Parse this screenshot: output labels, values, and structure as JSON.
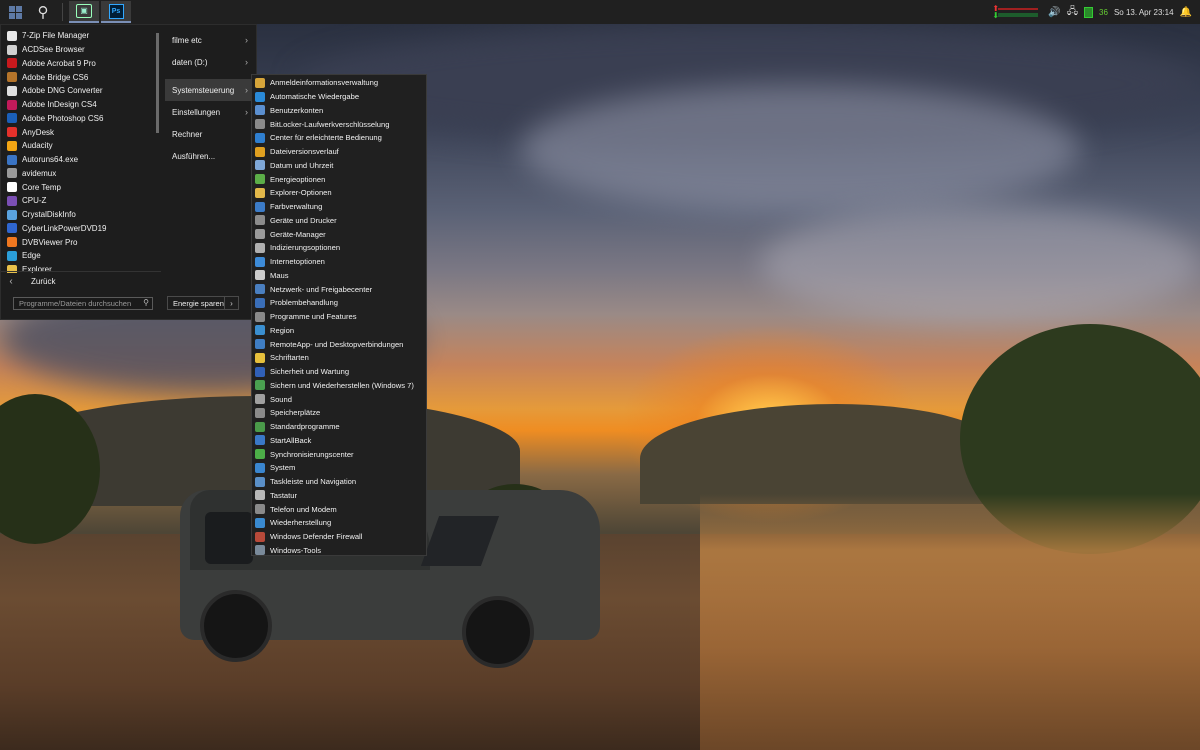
{
  "taskbar": {
    "clock": "So 13. Apr  23:14",
    "tray_number": "36",
    "apps": [
      {
        "name": "control-panel-app",
        "label": ""
      },
      {
        "name": "photoshop-app",
        "label": "Ps"
      }
    ]
  },
  "start_menu": {
    "programs": [
      {
        "label": "7-Zip File Manager",
        "color": "#e8e8e8"
      },
      {
        "label": "ACDSee Browser",
        "color": "#d0d0d0"
      },
      {
        "label": "Adobe Acrobat 9 Pro",
        "color": "#c8191d"
      },
      {
        "label": "Adobe Bridge CS6",
        "color": "#b5742a"
      },
      {
        "label": "Adobe DNG Converter",
        "color": "#e0e0e0"
      },
      {
        "label": "Adobe InDesign CS4",
        "color": "#c21a5a"
      },
      {
        "label": "Adobe Photoshop CS6",
        "color": "#1b5fb8"
      },
      {
        "label": "AnyDesk",
        "color": "#e5312b"
      },
      {
        "label": "Audacity",
        "color": "#f3a514"
      },
      {
        "label": "Autoruns64.exe",
        "color": "#3a74c4"
      },
      {
        "label": "avidemux",
        "color": "#9a9a9a"
      },
      {
        "label": "Core Temp",
        "color": "#ffffff"
      },
      {
        "label": "CPU-Z",
        "color": "#7b4fb4"
      },
      {
        "label": "CrystalDiskInfo",
        "color": "#5aa3e0"
      },
      {
        "label": "CyberLinkPowerDVD19",
        "color": "#2f66d0"
      },
      {
        "label": "DVBViewer Pro",
        "color": "#f07820"
      },
      {
        "label": "Edge",
        "color": "#2b9ed8"
      },
      {
        "label": "Explorer",
        "color": "#e8c04a"
      }
    ],
    "back_label": "Zurück",
    "search_placeholder": "Programme/Dateien durchsuchen",
    "right_items": [
      {
        "label": "filme etc",
        "has_arrow": true
      },
      {
        "label": "daten (D:)",
        "has_arrow": true
      },
      {
        "label": "Systemsteuerung",
        "has_arrow": true,
        "active": true
      },
      {
        "label": "Einstellungen",
        "has_arrow": true
      },
      {
        "label": "Rechner",
        "has_arrow": false
      },
      {
        "label": "Ausführen...",
        "has_arrow": false
      }
    ],
    "power_label": "Energie sparen"
  },
  "control_panel": {
    "items": [
      {
        "label": "Anmeldeinformationsverwaltung",
        "color": "#d6a53a"
      },
      {
        "label": "Automatische Wiedergabe",
        "color": "#2a8ad8"
      },
      {
        "label": "Benutzerkonten",
        "color": "#5b8fcf"
      },
      {
        "label": "BitLocker-Laufwerkverschlüsselung",
        "color": "#8a8a8a"
      },
      {
        "label": "Center für erleichterte Bedienung",
        "color": "#2f7fd0"
      },
      {
        "label": "Dateiversionsverlauf",
        "color": "#e0a020"
      },
      {
        "label": "Datum und Uhrzeit",
        "color": "#7fa8d8"
      },
      {
        "label": "Energieoptionen",
        "color": "#5cae48"
      },
      {
        "label": "Explorer-Optionen",
        "color": "#e2b84a"
      },
      {
        "label": "Farbverwaltung",
        "color": "#3c7cc8"
      },
      {
        "label": "Geräte und Drucker",
        "color": "#8c8c8c"
      },
      {
        "label": "Geräte-Manager",
        "color": "#9a9a9a"
      },
      {
        "label": "Indizierungsoptionen",
        "color": "#b0b0b0"
      },
      {
        "label": "Internetoptionen",
        "color": "#3d8bd8"
      },
      {
        "label": "Maus",
        "color": "#cccccc"
      },
      {
        "label": "Netzwerk- und Freigabecenter",
        "color": "#4a7fc0"
      },
      {
        "label": "Problembehandlung",
        "color": "#3a6eb8"
      },
      {
        "label": "Programme und Features",
        "color": "#8a8a8a"
      },
      {
        "label": "Region",
        "color": "#3a8fd0"
      },
      {
        "label": "RemoteApp- und Desktopverbindungen",
        "color": "#3f7ec4"
      },
      {
        "label": "Schriftarten",
        "color": "#e6c03c"
      },
      {
        "label": "Sicherheit und Wartung",
        "color": "#3060b8"
      },
      {
        "label": "Sichern und Wiederherstellen (Windows 7)",
        "color": "#4aa050"
      },
      {
        "label": "Sound",
        "color": "#a0a0a0"
      },
      {
        "label": "Speicherplätze",
        "color": "#8a8a8a"
      },
      {
        "label": "Standardprogramme",
        "color": "#4a9a4a"
      },
      {
        "label": "StartAllBack",
        "color": "#3a78c8"
      },
      {
        "label": "Synchronisierungscenter",
        "color": "#4cae48"
      },
      {
        "label": "System",
        "color": "#3a86d0"
      },
      {
        "label": "Taskleiste und Navigation",
        "color": "#5a8fc8"
      },
      {
        "label": "Tastatur",
        "color": "#b8b8b8"
      },
      {
        "label": "Telefon und Modem",
        "color": "#8a8a8a"
      },
      {
        "label": "Wiederherstellung",
        "color": "#3a8ad0"
      },
      {
        "label": "Windows Defender Firewall",
        "color": "#b84a3a"
      },
      {
        "label": "Windows-Tools",
        "color": "#7a8a9a"
      }
    ]
  }
}
